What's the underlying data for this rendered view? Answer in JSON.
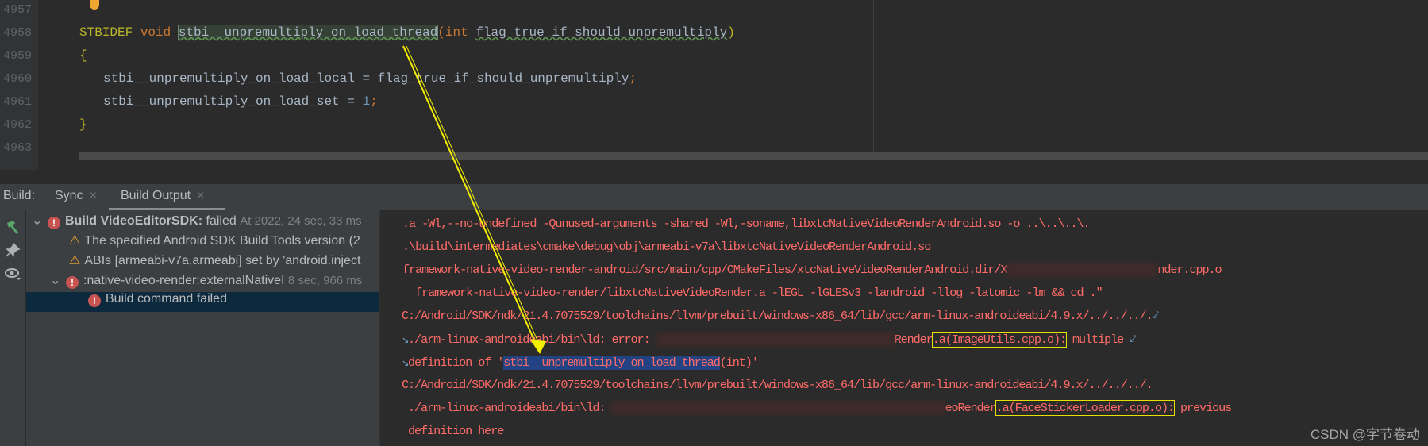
{
  "editor": {
    "line_numbers": [
      "4957",
      "4958",
      "4959",
      "4960",
      "4961",
      "4962",
      "4963"
    ],
    "lines": {
      "l4958": {
        "macro": "STBIDEF",
        "type": "void",
        "func": "stbi__unpremultiply_on_load_thread",
        "paren_open": "(",
        "ptype": "int",
        "param": "flag_true_if_should_unpremultiply",
        "paren_close": ")"
      },
      "l4959": "{",
      "l4960": {
        "lhs": "stbi__unpremultiply_on_load_local = flag_true_if_should_unpremultiply",
        "semi": ";"
      },
      "l4961": {
        "lhs": "stbi__unpremultiply_on_load_set = ",
        "num": "1",
        "semi": ";"
      },
      "l4962": "}"
    }
  },
  "build_panel": {
    "label": "Build:",
    "tabs": [
      {
        "label": "Sync",
        "close": "×"
      },
      {
        "label": "Build Output",
        "close": "×",
        "active": true
      }
    ],
    "toolbar_icons": [
      "hammer-icon",
      "pin-icon",
      "eye-icon"
    ],
    "tree": [
      {
        "title": "Build VideoEditorSDK:",
        "status": "failed",
        "meta": "At 2022, 24 sec, 33 ms",
        "icon": "error"
      },
      {
        "title": "The specified Android SDK Build Tools version (2",
        "icon": "warning"
      },
      {
        "title": "ABIs [armeabi-v7a,armeabi] set by 'android.inject",
        "icon": "warning"
      },
      {
        "title": ":native-video-render:externalNativeI",
        "meta": "8 sec, 966 ms",
        "icon": "error"
      },
      {
        "title": "Build command failed",
        "icon": "error",
        "selected": true
      }
    ]
  },
  "output": {
    "l1": "   .a -Wl,--no-undefined -Qunused-arguments -shared -Wl,-soname,libxtcNativeVideoRenderAndroid.so -o ..\\..\\..\\.",
    "l2": "   .\\build\\intermediates\\cmake\\debug\\obj\\armeabi-v7a\\libxtcNativeVideoRenderAndroid.so",
    "l3a": "   framework-native-video-render-android/src/main/cpp/CMakeFiles/xtcNativeVideoRenderAndroid.dir/X",
    "l3b": "nder.cpp.o",
    "l4": "     framework-native-video-render/libxtcNativeVideoRender.a -lEGL -lGLESv3 -landroid -llog -latomic -lm && cd .\"",
    "l5": "C:/Android/SDK/ndk/21.4.7075529/toolchains/llvm/prebuilt/windows-x86_64/lib/gcc/arm-linux-androideabi/4.9.x/../../../.",
    "l6a": "./arm-linux-androideabi/bin\\ld: error: ",
    "l6b": "Render",
    "l6c": ".a(ImageUtils.cpp.o):",
    "l6d": " multiple",
    "l7a": "definition of '",
    "l7b": "stbi__unpremultiply_on_load_thread",
    "l7c": "(int)'",
    "l8": "C:/Android/SDK/ndk/21.4.7075529/toolchains/llvm/prebuilt/windows-x86_64/lib/gcc/arm-linux-androideabi/4.9.x/../../../.",
    "l9a": " ./arm-linux-androideabi/bin\\ld: ",
    "l9b": "eoRender",
    "l9c": ".a(FaceStickerLoader.cpp.o):",
    "l9d": " previous",
    "l10": " definition here",
    "wrap_glyph": "⤦",
    "wrap_start_glyph": "↘"
  },
  "watermark": "CSDN @字节卷动",
  "colors": {
    "error_text": "#ff6b68",
    "annotation": "#e8e000",
    "selection": "#214283"
  }
}
